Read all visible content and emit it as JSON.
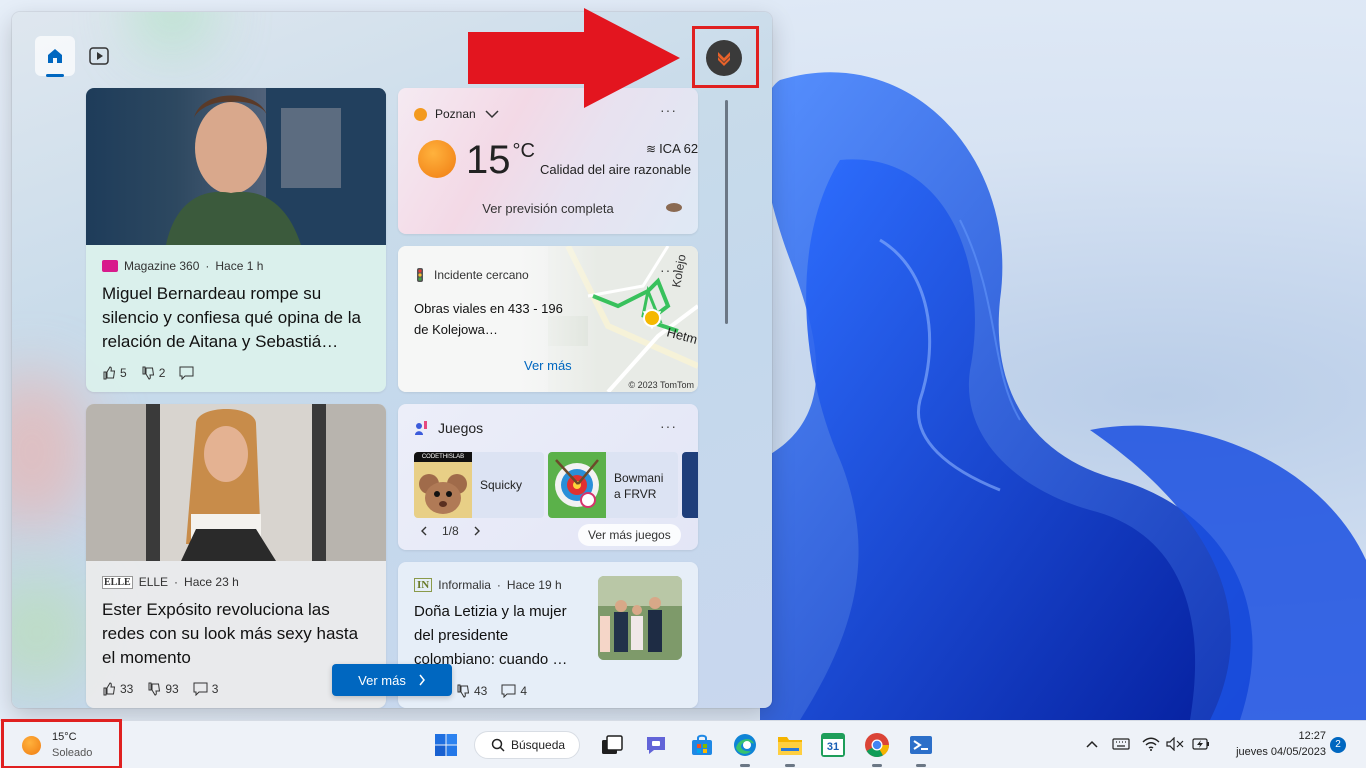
{
  "panel": {
    "tabs": [
      {
        "name": "Home"
      },
      {
        "name": "Watch"
      }
    ]
  },
  "articles": [
    {
      "source": "Magazine 360",
      "time": "Hace 1 h",
      "title": "Miguel Bernardeau rompe su silencio y confiesa qué opina de la relación de Aitana y Sebastiá…",
      "likes": "5",
      "dislikes": "2"
    },
    {
      "source": "ELLE",
      "time": "Hace 23 h",
      "title": "Ester Expósito revoluciona las redes con su look más sexy hasta el momento",
      "likes": "33",
      "dislikes": "93",
      "comments": "3"
    },
    {
      "source": "Informalia",
      "time": "Hace 19 h",
      "title": "Doña Letizia y la mujer del presidente colombiano: cuando …",
      "dislikes": "43",
      "comments": "4"
    }
  ],
  "weather": {
    "location": "Poznan",
    "temp": "15",
    "unit": "°C",
    "aqi": "ICA 62",
    "aqi_desc": "Calidad del aire razonable",
    "forecast": "Ver previsión completa"
  },
  "traffic": {
    "header": "Incidente cercano",
    "text": "Obras viales en 433 - 196 de Kolejowa…",
    "more": "Ver más",
    "copyright": "© 2023 TomTom",
    "street1": "Kolejo",
    "street2": "Hetm"
  },
  "games": {
    "title": "Juegos",
    "items": [
      {
        "name": "Squicky"
      },
      {
        "name": "Bowmania FRVR"
      }
    ],
    "pager": "1/8",
    "more": "Ver más juegos",
    "brand": "CODETHISLAB"
  },
  "ver_mas": "Ver más",
  "taskbar": {
    "weather_temp": "15°C",
    "weather_desc": "Soleado",
    "search": "Búsqueda",
    "time": "12:27",
    "date": "jueves 04/05/2023",
    "notifications": "2",
    "calendar": "31"
  },
  "colors": {
    "accent": "#0067c0",
    "annotation": "#e02020"
  }
}
